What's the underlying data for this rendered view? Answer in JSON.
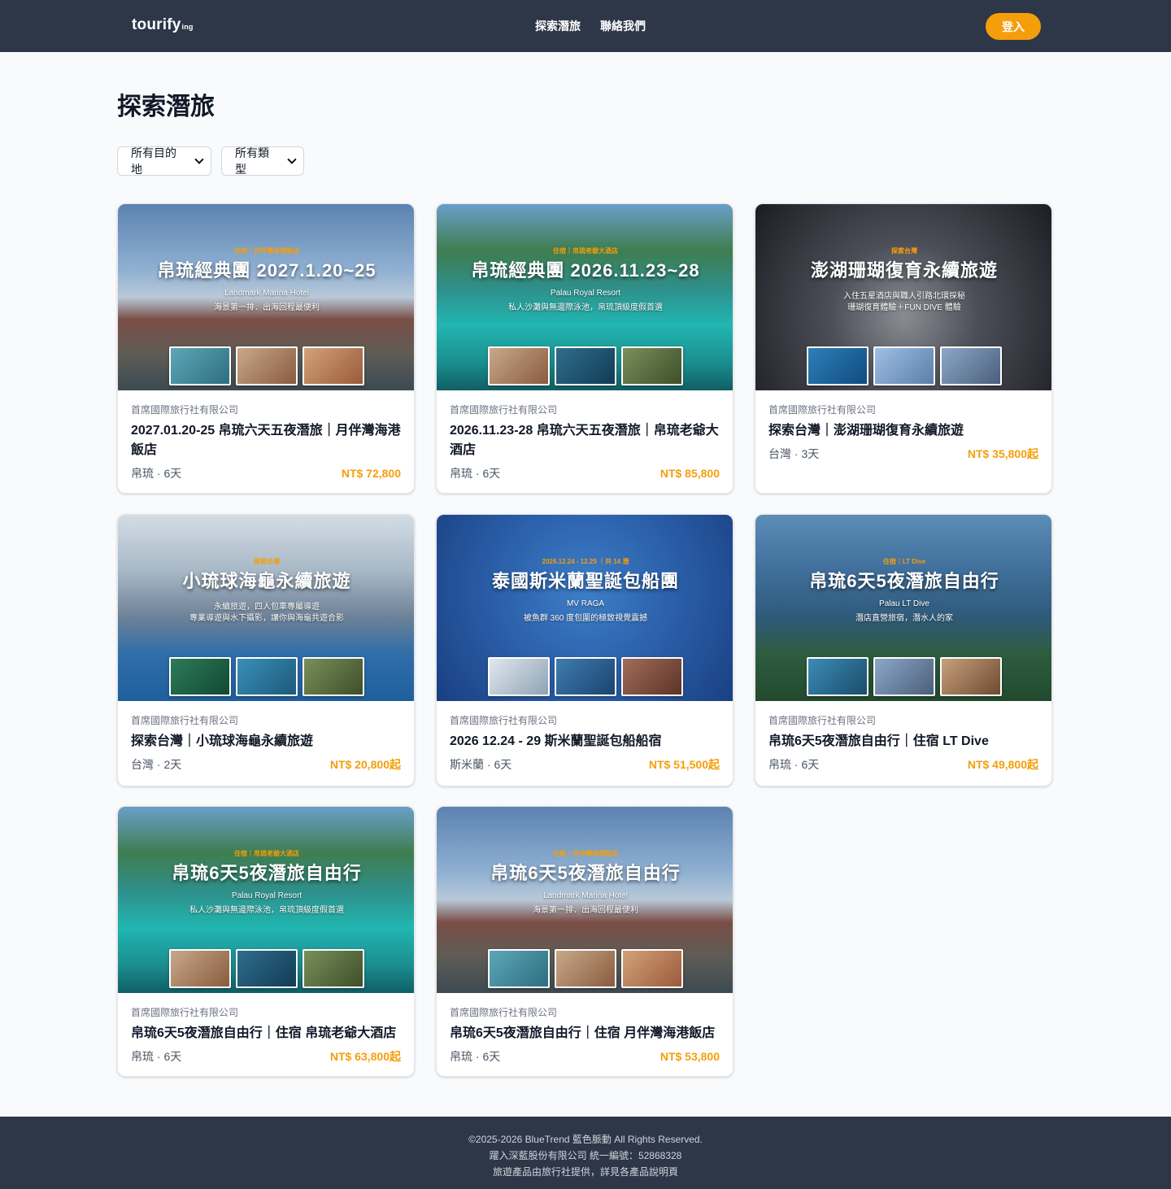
{
  "header": {
    "logo": "tourify",
    "logo_suffix": "ing",
    "nav": [
      "探索潛旅",
      "聯絡我們"
    ],
    "login": "登入"
  },
  "page": {
    "title": "探索潛旅",
    "filters": [
      "所有目的地",
      "所有類型"
    ]
  },
  "cards": [
    {
      "img_tag": "住宿｜月伴灣海港飯店",
      "img_title": "帛琉經典團 2027.1.20~25",
      "img_sub": "Landmark Marina Hotel",
      "img_sub2": "海景第一排．出海回程最便利",
      "agency": "首席國際旅行社有限公司",
      "name": "2027.01.20-25 帛琉六天五夜潛旅｜月伴灣海港飯店",
      "location": "帛琉 · 6天",
      "price": "NT$ 72,800"
    },
    {
      "img_tag": "住宿｜帛琉老爺大酒店",
      "img_title": "帛琉經典團 2026.11.23~28",
      "img_sub": "Palau Royal Resort",
      "img_sub2": "私人沙灘與無邊際泳池，帛琉頂級度假首選",
      "agency": "首席國際旅行社有限公司",
      "name": "2026.11.23-28 帛琉六天五夜潛旅｜帛琉老爺大酒店",
      "location": "帛琉 · 6天",
      "price": "NT$ 85,800"
    },
    {
      "img_tag": "探索台灣",
      "img_title": "澎湖珊瑚復育永續旅遊",
      "img_sub": "入住五星酒店與職人引路北環探秘",
      "img_sub2": "珊瑚復育體驗＋FUN DIVE 體驗",
      "agency": "首席國際旅行社有限公司",
      "name": "探索台灣｜澎湖珊瑚復育永續旅遊",
      "location": "台灣 · 3天",
      "price": "NT$ 35,800起"
    },
    {
      "img_tag": "探索台灣",
      "img_title": "小琉球海龜永續旅遊",
      "img_sub": "永續旅遊，四人包車專屬導遊",
      "img_sub2": "專業導遊與水下攝影，讓你與海龜共遊合影",
      "agency": "首席國際旅行社有限公司",
      "name": "探索台灣｜小琉球海龜永續旅遊",
      "location": "台灣 · 2天",
      "price": "NT$ 20,800起"
    },
    {
      "img_tag": "2026.12.24 - 12.29 ｜共 14 潛",
      "img_title": "泰國斯米蘭聖誕包船團",
      "img_sub": "MV RAGA",
      "img_sub2": "被魚群 360 度包圍的極致視覺震撼",
      "agency": "首席國際旅行社有限公司",
      "name": "2026 12.24 - 29 斯米蘭聖誕包船船宿",
      "location": "斯米蘭 · 6天",
      "price": "NT$ 51,500起"
    },
    {
      "img_tag": "住宿｜LT Dive",
      "img_title": "帛琉6天5夜潛旅自由行",
      "img_sub": "Palau LT Dive",
      "img_sub2": "潛店直營旅宿，潛水人的家",
      "agency": "首席國際旅行社有限公司",
      "name": "帛琉6天5夜潛旅自由行｜住宿 LT Dive",
      "location": "帛琉 · 6天",
      "price": "NT$ 49,800起"
    },
    {
      "img_tag": "住宿｜帛琉老爺大酒店",
      "img_title": "帛琉6天5夜潛旅自由行",
      "img_sub": "Palau Royal Resort",
      "img_sub2": "私人沙灘與無邊際泳池，帛琉頂級度假首選",
      "agency": "首席國際旅行社有限公司",
      "name": "帛琉6天5夜潛旅自由行｜住宿 帛琉老爺大酒店",
      "location": "帛琉 · 6天",
      "price": "NT$ 63,800起"
    },
    {
      "img_tag": "住宿｜月伴灣海港飯店",
      "img_title": "帛琉6天5夜潛旅自由行",
      "img_sub": "Landmark Marina Hotel",
      "img_sub2": "海景第一排．出海回程最便利",
      "agency": "首席國際旅行社有限公司",
      "name": "帛琉6天5夜潛旅自由行｜住宿 月伴灣海港飯店",
      "location": "帛琉 · 6天",
      "price": "NT$ 53,800"
    }
  ],
  "footer": {
    "line1": "©2025-2026 BlueTrend 藍色脈動 All Rights Reserved.",
    "line2": "躍入深藍股份有限公司 統一編號：52868328",
    "line3": "旅遊產品由旅行社提供，詳見各產品說明頁"
  }
}
